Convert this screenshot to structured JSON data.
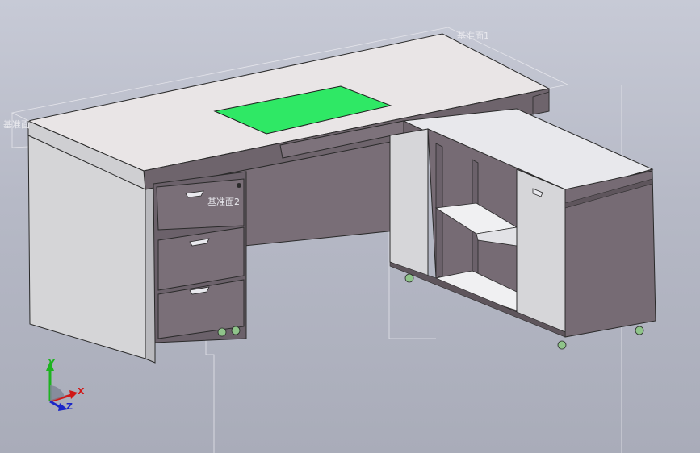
{
  "viewport": {
    "background_top": "#c7cad6",
    "background_bottom": "#a9acb9"
  },
  "planes": {
    "plane1_label": "基准面1",
    "plane2_label": "基准面2",
    "plane3_label": "基准面"
  },
  "triad": {
    "x_label": "X",
    "y_label": "Y",
    "z_label": "Z",
    "x_color": "#d01818",
    "y_color": "#1db320",
    "z_color": "#1a26c8"
  },
  "colors": {
    "desk_top": "#e9e5e6",
    "body_side": "#d4d4d6",
    "cabinet_front": "#766b74",
    "cabinet_dark": "#655b63",
    "green_pad": "#2fe865",
    "caster": "#8fc48a"
  }
}
